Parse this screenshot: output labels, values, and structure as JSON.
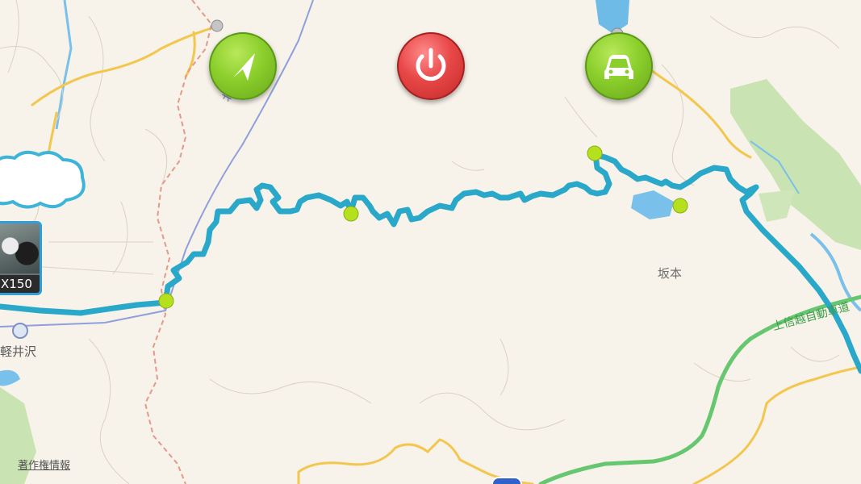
{
  "buttons": {
    "navigate": {
      "icon": "navigation-arrow-icon"
    },
    "power": {
      "icon": "power-icon"
    },
    "car": {
      "icon": "car-icon"
    }
  },
  "labels": {
    "rail_line": "北陸新幹線",
    "place": "坂本",
    "expressway": "上信越自動車道",
    "station": "軽井沢"
  },
  "photo": {
    "caption": "X150"
  },
  "copyright": "著作権情報",
  "colors": {
    "route": "#2aa8c9",
    "waypoint": "#b4e01e",
    "expressway": "#66c770",
    "national_road": "#f3c64e",
    "rail": "#8f9fdc",
    "prefecture_border": "#e39a8a",
    "water": "#6fbbe7",
    "forest": "#c7e3b4"
  }
}
